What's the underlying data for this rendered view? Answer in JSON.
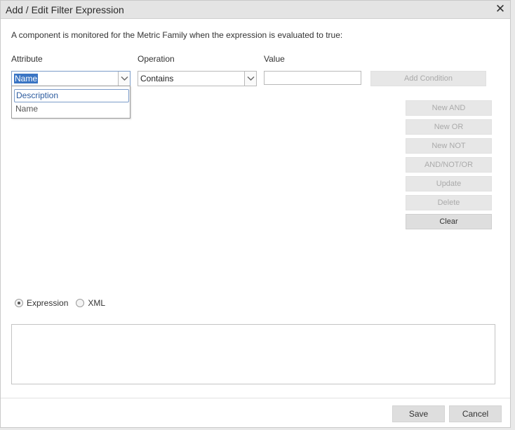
{
  "dialog": {
    "title": "Add / Edit Filter Expression",
    "close_glyph": "✕",
    "description": "A component is monitored for the Metric Family when the expression is evaluated to true:"
  },
  "form": {
    "attribute_label": "Attribute",
    "operation_label": "Operation",
    "value_label": "Value",
    "attribute_value": "Name",
    "operation_value": "Contains",
    "value_value": "",
    "add_condition_label": "Add Condition"
  },
  "attribute_options": [
    "Description",
    "Name"
  ],
  "actions": {
    "new_and": "New AND",
    "new_or": "New OR",
    "new_not": "New NOT",
    "and_not_or": "AND/NOT/OR",
    "update": "Update",
    "delete": "Delete",
    "clear": "Clear"
  },
  "view_mode": {
    "expression_label": "Expression",
    "xml_label": "XML",
    "selected": "Expression"
  },
  "footer": {
    "save_label": "Save",
    "cancel_label": "Cancel"
  },
  "icons": {
    "close": "close-icon",
    "dropdown": "chevron-down-icon"
  }
}
